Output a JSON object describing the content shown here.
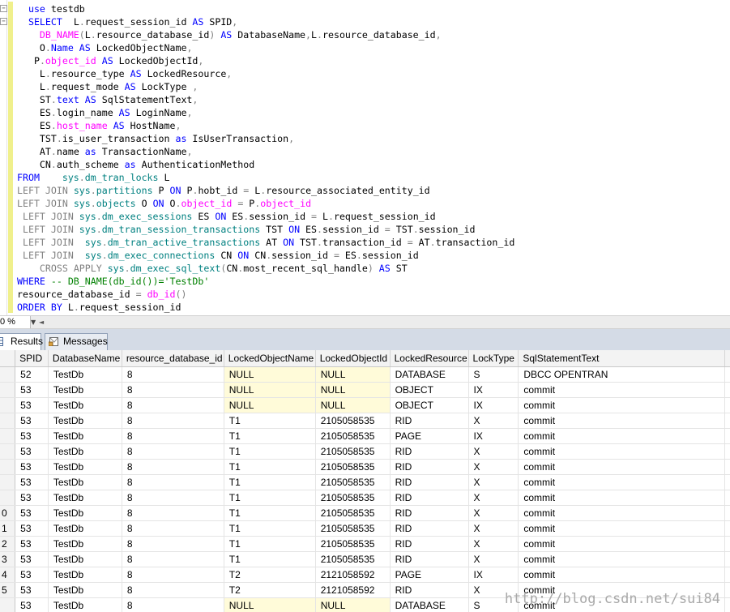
{
  "editor": {
    "lines": [
      [
        [
          "kw",
          "use"
        ],
        [
          "tx",
          " testdb"
        ]
      ],
      [
        [
          "kw",
          "SELECT"
        ],
        [
          "tx",
          "  L"
        ],
        [
          "op",
          "."
        ],
        [
          "tx",
          "request_session_id "
        ],
        [
          "kw",
          "AS"
        ],
        [
          "tx",
          " SPID"
        ],
        [
          "op",
          ","
        ]
      ],
      [
        [
          "fn",
          "DB_NAME"
        ],
        [
          "op",
          "("
        ],
        [
          "tx",
          "L"
        ],
        [
          "op",
          "."
        ],
        [
          "tx",
          "resource_database_id"
        ],
        [
          "op",
          ")"
        ],
        [
          "tx",
          " "
        ],
        [
          "kw",
          "AS"
        ],
        [
          "tx",
          " DatabaseName"
        ],
        [
          "op",
          ","
        ],
        [
          "tx",
          "L"
        ],
        [
          "op",
          "."
        ],
        [
          "tx",
          "resource_database_id"
        ],
        [
          "op",
          ","
        ]
      ],
      [
        [
          "tx",
          "O"
        ],
        [
          "op",
          "."
        ],
        [
          "kw",
          "Name"
        ],
        [
          "tx",
          " "
        ],
        [
          "kw",
          "AS"
        ],
        [
          "tx",
          " LockedObjectName"
        ],
        [
          "op",
          ","
        ]
      ],
      [
        [
          "tx",
          "P"
        ],
        [
          "op",
          "."
        ],
        [
          "fn",
          "object_id"
        ],
        [
          "tx",
          " "
        ],
        [
          "kw",
          "AS"
        ],
        [
          "tx",
          " LockedObjectId"
        ],
        [
          "op",
          ","
        ]
      ],
      [
        [
          "tx",
          "L"
        ],
        [
          "op",
          "."
        ],
        [
          "tx",
          "resource_type "
        ],
        [
          "kw",
          "AS"
        ],
        [
          "tx",
          " LockedResource"
        ],
        [
          "op",
          ","
        ]
      ],
      [
        [
          "tx",
          "L"
        ],
        [
          "op",
          "."
        ],
        [
          "tx",
          "request_mode "
        ],
        [
          "kw",
          "AS"
        ],
        [
          "tx",
          " LockType "
        ],
        [
          "op",
          ","
        ]
      ],
      [
        [
          "tx",
          "ST"
        ],
        [
          "op",
          "."
        ],
        [
          "kw",
          "text"
        ],
        [
          "tx",
          " "
        ],
        [
          "kw",
          "AS"
        ],
        [
          "tx",
          " SqlStatementText"
        ],
        [
          "op",
          ","
        ]
      ],
      [
        [
          "tx",
          "ES"
        ],
        [
          "op",
          "."
        ],
        [
          "tx",
          "login_name "
        ],
        [
          "kw",
          "AS"
        ],
        [
          "tx",
          " LoginName"
        ],
        [
          "op",
          ","
        ]
      ],
      [
        [
          "tx",
          "ES"
        ],
        [
          "op",
          "."
        ],
        [
          "fn",
          "host_name"
        ],
        [
          "tx",
          " "
        ],
        [
          "kw",
          "AS"
        ],
        [
          "tx",
          " HostName"
        ],
        [
          "op",
          ","
        ]
      ],
      [
        [
          "tx",
          "TST"
        ],
        [
          "op",
          "."
        ],
        [
          "tx",
          "is_user_transaction "
        ],
        [
          "kw",
          "as"
        ],
        [
          "tx",
          " IsUserTransaction"
        ],
        [
          "op",
          ","
        ]
      ],
      [
        [
          "tx",
          "AT"
        ],
        [
          "op",
          "."
        ],
        [
          "tx",
          "name "
        ],
        [
          "kw",
          "as"
        ],
        [
          "tx",
          " TransactionName"
        ],
        [
          "op",
          ","
        ]
      ],
      [
        [
          "tx",
          "CN"
        ],
        [
          "op",
          "."
        ],
        [
          "tx",
          "auth_scheme "
        ],
        [
          "kw",
          "as"
        ],
        [
          "tx",
          " AuthenticationMethod"
        ]
      ],
      [
        [
          "kw",
          "FROM"
        ],
        [
          "tx",
          "    "
        ],
        [
          "id",
          "sys"
        ],
        [
          "op",
          "."
        ],
        [
          "id",
          "dm_tran_locks"
        ],
        [
          "tx",
          " L"
        ]
      ],
      [
        [
          "op",
          "LEFT"
        ],
        [
          "tx",
          " "
        ],
        [
          "op",
          "JOIN"
        ],
        [
          "tx",
          " "
        ],
        [
          "id",
          "sys"
        ],
        [
          "op",
          "."
        ],
        [
          "id",
          "partitions"
        ],
        [
          "tx",
          " P "
        ],
        [
          "kw",
          "ON"
        ],
        [
          "tx",
          " P"
        ],
        [
          "op",
          "."
        ],
        [
          "tx",
          "hobt_id "
        ],
        [
          "op",
          "="
        ],
        [
          "tx",
          " L"
        ],
        [
          "op",
          "."
        ],
        [
          "tx",
          "resource_associated_entity_id"
        ]
      ],
      [
        [
          "op",
          "LEFT"
        ],
        [
          "tx",
          " "
        ],
        [
          "op",
          "JOIN"
        ],
        [
          "tx",
          " "
        ],
        [
          "id",
          "sys"
        ],
        [
          "op",
          "."
        ],
        [
          "id",
          "objects"
        ],
        [
          "tx",
          " O "
        ],
        [
          "kw",
          "ON"
        ],
        [
          "tx",
          " O"
        ],
        [
          "op",
          "."
        ],
        [
          "fn",
          "object_id"
        ],
        [
          "tx",
          " "
        ],
        [
          "op",
          "="
        ],
        [
          "tx",
          " P"
        ],
        [
          "op",
          "."
        ],
        [
          "fn",
          "object_id"
        ]
      ],
      [
        [
          "op",
          "LEFT"
        ],
        [
          "tx",
          " "
        ],
        [
          "op",
          "JOIN"
        ],
        [
          "tx",
          " "
        ],
        [
          "id",
          "sys"
        ],
        [
          "op",
          "."
        ],
        [
          "id",
          "dm_exec_sessions"
        ],
        [
          "tx",
          " ES "
        ],
        [
          "kw",
          "ON"
        ],
        [
          "tx",
          " ES"
        ],
        [
          "op",
          "."
        ],
        [
          "tx",
          "session_id "
        ],
        [
          "op",
          "="
        ],
        [
          "tx",
          " L"
        ],
        [
          "op",
          "."
        ],
        [
          "tx",
          "request_session_id"
        ]
      ],
      [
        [
          "op",
          "LEFT"
        ],
        [
          "tx",
          " "
        ],
        [
          "op",
          "JOIN"
        ],
        [
          "tx",
          " "
        ],
        [
          "id",
          "sys"
        ],
        [
          "op",
          "."
        ],
        [
          "id",
          "dm_tran_session_transactions"
        ],
        [
          "tx",
          " TST "
        ],
        [
          "kw",
          "ON"
        ],
        [
          "tx",
          " ES"
        ],
        [
          "op",
          "."
        ],
        [
          "tx",
          "session_id "
        ],
        [
          "op",
          "="
        ],
        [
          "tx",
          " TST"
        ],
        [
          "op",
          "."
        ],
        [
          "tx",
          "session_id"
        ]
      ],
      [
        [
          "op",
          "LEFT"
        ],
        [
          "tx",
          " "
        ],
        [
          "op",
          "JOIN"
        ],
        [
          "tx",
          "  "
        ],
        [
          "id",
          "sys"
        ],
        [
          "op",
          "."
        ],
        [
          "id",
          "dm_tran_active_transactions"
        ],
        [
          "tx",
          " AT "
        ],
        [
          "kw",
          "ON"
        ],
        [
          "tx",
          " TST"
        ],
        [
          "op",
          "."
        ],
        [
          "tx",
          "transaction_id "
        ],
        [
          "op",
          "="
        ],
        [
          "tx",
          " AT"
        ],
        [
          "op",
          "."
        ],
        [
          "tx",
          "transaction_id"
        ]
      ],
      [
        [
          "op",
          "LEFT"
        ],
        [
          "tx",
          " "
        ],
        [
          "op",
          "JOIN"
        ],
        [
          "tx",
          "  "
        ],
        [
          "id",
          "sys"
        ],
        [
          "op",
          "."
        ],
        [
          "id",
          "dm_exec_connections"
        ],
        [
          "tx",
          " CN "
        ],
        [
          "kw",
          "ON"
        ],
        [
          "tx",
          " CN"
        ],
        [
          "op",
          "."
        ],
        [
          "tx",
          "session_id "
        ],
        [
          "op",
          "="
        ],
        [
          "tx",
          " ES"
        ],
        [
          "op",
          "."
        ],
        [
          "tx",
          "session_id"
        ]
      ],
      [
        [
          "op",
          "CROSS"
        ],
        [
          "tx",
          " "
        ],
        [
          "op",
          "APPLY"
        ],
        [
          "tx",
          " "
        ],
        [
          "id",
          "sys"
        ],
        [
          "op",
          "."
        ],
        [
          "id",
          "dm_exec_sql_text"
        ],
        [
          "op",
          "("
        ],
        [
          "tx",
          "CN"
        ],
        [
          "op",
          "."
        ],
        [
          "tx",
          "most_recent_sql_handle"
        ],
        [
          "op",
          ")"
        ],
        [
          "tx",
          " "
        ],
        [
          "kw",
          "AS"
        ],
        [
          "tx",
          " ST"
        ]
      ],
      [
        [
          "kw",
          "WHERE"
        ],
        [
          "tx",
          " "
        ],
        [
          "cmt",
          "-- DB_NAME(db_id())='TestDb'"
        ]
      ],
      [
        [
          "tx",
          "resource_database_id "
        ],
        [
          "op",
          "="
        ],
        [
          "tx",
          " "
        ],
        [
          "fn",
          "db_id"
        ],
        [
          "op",
          "()"
        ]
      ],
      [
        [
          "kw",
          "ORDER"
        ],
        [
          "tx",
          " "
        ],
        [
          "kw",
          "BY"
        ],
        [
          "tx",
          " L"
        ],
        [
          "op",
          "."
        ],
        [
          "tx",
          "request_session_id"
        ]
      ]
    ]
  },
  "zoom": {
    "value": "0 %"
  },
  "tabs": {
    "results": "Results",
    "messages": "Messages"
  },
  "grid": {
    "columns": [
      "SPID",
      "DatabaseName",
      "resource_database_id",
      "LockedObjectName",
      "LockedObjectId",
      "LockedResource",
      "LockType",
      "SqlStatementText"
    ],
    "rows": [
      {
        "n": "",
        "c": [
          "52",
          "TestDb",
          "8",
          "NULL",
          "NULL",
          "DATABASE",
          "S",
          "DBCC OPENTRAN"
        ]
      },
      {
        "n": "",
        "c": [
          "53",
          "TestDb",
          "8",
          "NULL",
          "NULL",
          "OBJECT",
          "IX",
          " commit"
        ]
      },
      {
        "n": "",
        "c": [
          "53",
          "TestDb",
          "8",
          "NULL",
          "NULL",
          "OBJECT",
          "IX",
          " commit"
        ]
      },
      {
        "n": "",
        "c": [
          "53",
          "TestDb",
          "8",
          "T1",
          "2105058535",
          "RID",
          "X",
          " commit"
        ]
      },
      {
        "n": "",
        "c": [
          "53",
          "TestDb",
          "8",
          "T1",
          "2105058535",
          "PAGE",
          "IX",
          " commit"
        ]
      },
      {
        "n": "",
        "c": [
          "53",
          "TestDb",
          "8",
          "T1",
          "2105058535",
          "RID",
          "X",
          " commit"
        ]
      },
      {
        "n": "",
        "c": [
          "53",
          "TestDb",
          "8",
          "T1",
          "2105058535",
          "RID",
          "X",
          " commit"
        ]
      },
      {
        "n": "",
        "c": [
          "53",
          "TestDb",
          "8",
          "T1",
          "2105058535",
          "RID",
          "X",
          " commit"
        ]
      },
      {
        "n": "",
        "c": [
          "53",
          "TestDb",
          "8",
          "T1",
          "2105058535",
          "RID",
          "X",
          " commit"
        ]
      },
      {
        "n": "0",
        "c": [
          "53",
          "TestDb",
          "8",
          "T1",
          "2105058535",
          "RID",
          "X",
          " commit"
        ]
      },
      {
        "n": "1",
        "c": [
          "53",
          "TestDb",
          "8",
          "T1",
          "2105058535",
          "RID",
          "X",
          " commit"
        ]
      },
      {
        "n": "2",
        "c": [
          "53",
          "TestDb",
          "8",
          "T1",
          "2105058535",
          "RID",
          "X",
          " commit"
        ]
      },
      {
        "n": "3",
        "c": [
          "53",
          "TestDb",
          "8",
          "T1",
          "2105058535",
          "RID",
          "X",
          " commit"
        ]
      },
      {
        "n": "4",
        "c": [
          "53",
          "TestDb",
          "8",
          "T2",
          "2121058592",
          "PAGE",
          "IX",
          " commit"
        ]
      },
      {
        "n": "5",
        "c": [
          "53",
          "TestDb",
          "8",
          "T2",
          "2121058592",
          "RID",
          "X",
          " commit"
        ]
      },
      {
        "n": "",
        "c": [
          "53",
          "TestDb",
          "8",
          "NULL",
          "NULL",
          "DATABASE",
          "S",
          " commit"
        ]
      }
    ]
  },
  "watermark": "http://blog.csdn.net/sui84"
}
